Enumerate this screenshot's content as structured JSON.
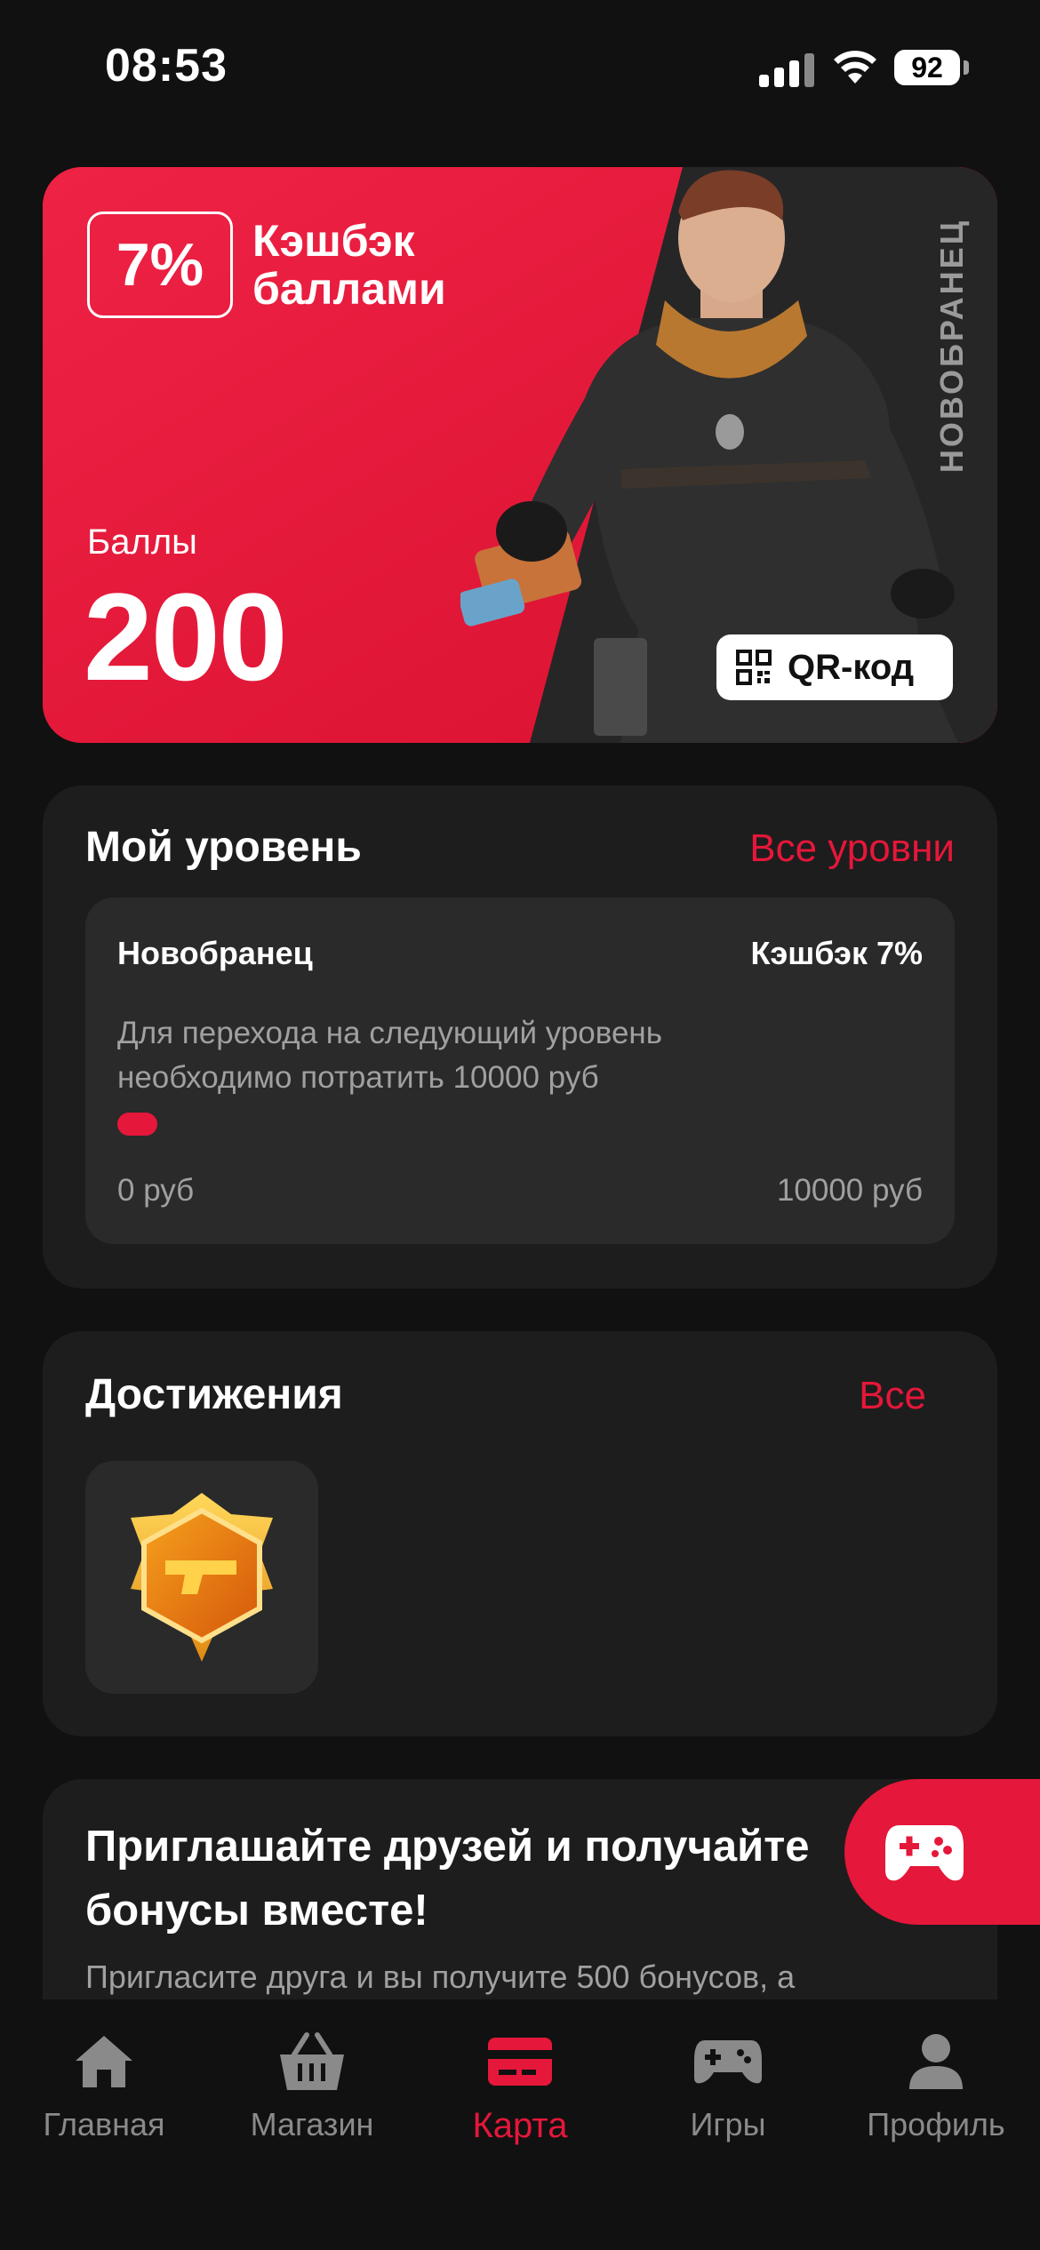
{
  "colors": {
    "accent": "#e5173a",
    "background": "#111111",
    "card": "#1d1d1d",
    "inner": "#2a2a2a",
    "muted": "#a0a0a0"
  },
  "status_bar": {
    "time": "08:53",
    "battery": "92"
  },
  "hero": {
    "cashback_percent": "7%",
    "cashback_line1": "Кэшбэк",
    "cashback_line2": "баллами",
    "points_label": "Баллы",
    "points_value": "200",
    "level_vertical": "НОВОБРАНЕЦ",
    "qr_label": "QR-код"
  },
  "level": {
    "title": "Мой уровень",
    "all_link": "Все уровни",
    "name": "Новобранец",
    "cashback": "Кэшбэк 7%",
    "description": "Для перехода на следующий уровень необходимо потратить 10000 руб",
    "progress_fraction": 0.05,
    "min": "0 руб",
    "max": "10000 руб"
  },
  "achievements": {
    "title": "Достижения",
    "all_link": "Все",
    "badges": [
      {
        "icon": "pistol-badge-icon"
      }
    ]
  },
  "invite": {
    "title": "Приглашайте друзей и получайте бонусы вместе!",
    "text": "Пригласите друга и вы получите 500 бонусов, а"
  },
  "tabbar": {
    "items": [
      {
        "label": "Главная",
        "icon": "home-icon"
      },
      {
        "label": "Магазин",
        "icon": "basket-icon"
      },
      {
        "label": "Карта",
        "icon": "card-icon",
        "active": true
      },
      {
        "label": "Игры",
        "icon": "gamepad-icon"
      },
      {
        "label": "Профиль",
        "icon": "user-icon"
      }
    ]
  }
}
